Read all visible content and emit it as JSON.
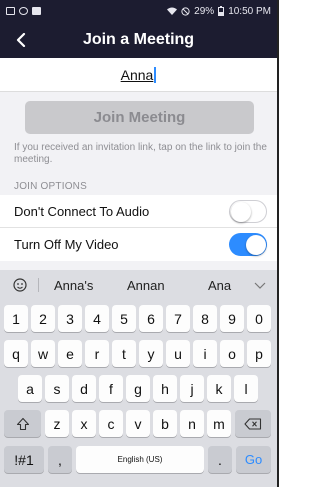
{
  "status_bar": {
    "battery": "29%",
    "time": "10:50 PM"
  },
  "navbar": {
    "title": "Join a Meeting"
  },
  "name_field": {
    "value": "Anna"
  },
  "join_button": {
    "label": "Join Meeting"
  },
  "hint": "If you received an invitation link, tap on the link to join the meeting.",
  "join_options": {
    "header": "JOIN OPTIONS",
    "options": [
      {
        "label": "Don't Connect To Audio",
        "on": false
      },
      {
        "label": "Turn Off My Video",
        "on": true
      }
    ]
  },
  "keyboard": {
    "suggestions": [
      "Anna's",
      "Annan",
      "Ana"
    ],
    "number_row": [
      "1",
      "2",
      "3",
      "4",
      "5",
      "6",
      "7",
      "8",
      "9",
      "0"
    ],
    "row1": [
      "q",
      "w",
      "e",
      "r",
      "t",
      "y",
      "u",
      "i",
      "o",
      "p"
    ],
    "row2": [
      "a",
      "s",
      "d",
      "f",
      "g",
      "h",
      "j",
      "k",
      "l"
    ],
    "row3": [
      "z",
      "x",
      "c",
      "v",
      "b",
      "n",
      "m"
    ],
    "symbols_key": "!#1",
    "comma_key": ",",
    "space_key": "English (US)",
    "period_key": ".",
    "go_key": "Go"
  },
  "colors": {
    "accent": "#2d8cff",
    "header_bg": "#1c1c30"
  }
}
